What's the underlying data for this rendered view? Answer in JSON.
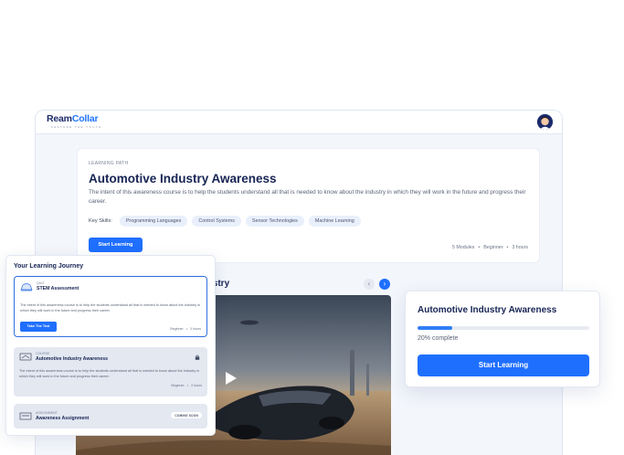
{
  "logo": {
    "part1": "Ream",
    "part2": "Collar",
    "tagline": "FEATURE THE YOUTH"
  },
  "hero": {
    "eyebrow": "LEARNING PATH",
    "title": "Automotive Industry Awareness",
    "description": "The intent of this awareness course is to help the students understand all that is needed to know about the industry in which they will work in the future and progress their career.",
    "skills_label": "Key Skills:",
    "skills": [
      "Programming Languages",
      "Control Systems",
      "Sensor Technologies",
      "Machine Learning"
    ],
    "button": "Start Learning",
    "meta": {
      "modules": "5 Modules",
      "level": "Beginner",
      "duration": "3 hours",
      "sep": "•"
    }
  },
  "section": {
    "title_visible": "ive Industry",
    "prev_icon": "chevron-left-icon",
    "next_icon": "chevron-right-icon"
  },
  "progress_card": {
    "title": "Automotive Industry Awareness",
    "progress": 0.2,
    "progress_text": "20% complete",
    "button": "Start Learning"
  },
  "journey": {
    "title": "Your Learning Journey",
    "items": [
      {
        "type": "QUIZ",
        "name": "STEM Assessment",
        "description": "The intent of this awareness course is to help the students understand all that is needed to know about the industry in which they will work in the future and progress their career.",
        "button": "Take The Test",
        "level": "Beginner",
        "duration": "3 hours",
        "icon": "quiz-icon"
      },
      {
        "type": "COURSE",
        "name": "Automotive Industry Awareness",
        "description": "The intent of this awareness course is to help the students understand all that is needed to know about the industry in which they will work in the future and progress their career.",
        "level": "Beginner",
        "duration": "3 hours",
        "icon": "course-icon",
        "locked": true
      },
      {
        "type": "ASSIGNMENT",
        "name": "Awareness Assignment",
        "badge": "COMING SOON",
        "icon": "assignment-icon"
      }
    ]
  },
  "colors": {
    "accent": "#1f6fff",
    "navy": "#172554",
    "panel_bg": "#f3f6fb"
  }
}
